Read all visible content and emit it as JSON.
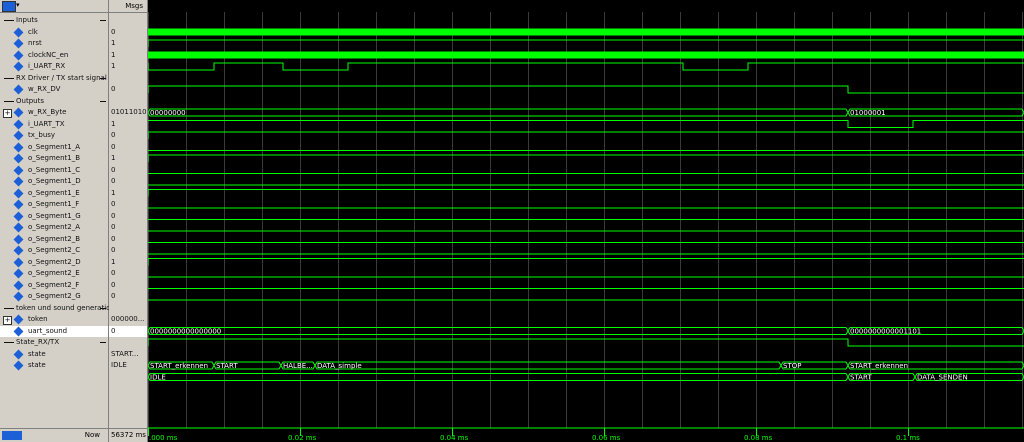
{
  "header": {
    "icon_name": "wave-tool-icon",
    "msgs_label": "Msgs"
  },
  "rows": [
    {
      "kind": "group",
      "name": "Inputs"
    },
    {
      "kind": "signal",
      "name": "clk",
      "value": "0"
    },
    {
      "kind": "signal",
      "name": "nrst",
      "value": "1"
    },
    {
      "kind": "signal",
      "name": "clockNC_en",
      "value": "1"
    },
    {
      "kind": "signal",
      "name": "i_UART_RX",
      "value": "1"
    },
    {
      "kind": "group",
      "name": "RX Driver / TX start signal"
    },
    {
      "kind": "signal",
      "name": "w_RX_DV",
      "value": "0"
    },
    {
      "kind": "group",
      "name": "Outputs"
    },
    {
      "kind": "signal",
      "name": "w_RX_Byte",
      "value": "01011010",
      "expandable": true
    },
    {
      "kind": "signal",
      "name": "i_UART_TX",
      "value": "1"
    },
    {
      "kind": "signal",
      "name": "tx_busy",
      "value": "0"
    },
    {
      "kind": "signal",
      "name": "o_Segment1_A",
      "value": "0"
    },
    {
      "kind": "signal",
      "name": "o_Segment1_B",
      "value": "1"
    },
    {
      "kind": "signal",
      "name": "o_Segment1_C",
      "value": "0"
    },
    {
      "kind": "signal",
      "name": "o_Segment1_D",
      "value": "0"
    },
    {
      "kind": "signal",
      "name": "o_Segment1_E",
      "value": "1"
    },
    {
      "kind": "signal",
      "name": "o_Segment1_F",
      "value": "0"
    },
    {
      "kind": "signal",
      "name": "o_Segment1_G",
      "value": "0"
    },
    {
      "kind": "signal",
      "name": "o_Segment2_A",
      "value": "0"
    },
    {
      "kind": "signal",
      "name": "o_Segment2_B",
      "value": "0"
    },
    {
      "kind": "signal",
      "name": "o_Segment2_C",
      "value": "0"
    },
    {
      "kind": "signal",
      "name": "o_Segment2_D",
      "value": "1"
    },
    {
      "kind": "signal",
      "name": "o_Segment2_E",
      "value": "0"
    },
    {
      "kind": "signal",
      "name": "o_Segment2_F",
      "value": "0"
    },
    {
      "kind": "signal",
      "name": "o_Segment2_G",
      "value": "0"
    },
    {
      "kind": "group",
      "name": "token und sound generation"
    },
    {
      "kind": "signal",
      "name": "token",
      "value": "000000...",
      "expandable": true
    },
    {
      "kind": "signal",
      "name": "uart_sound",
      "value": "0",
      "selected": true
    },
    {
      "kind": "group",
      "name": "State_RX/TX"
    },
    {
      "kind": "signal",
      "name": "state",
      "value": "START..."
    },
    {
      "kind": "signal",
      "name": "state",
      "value": "IDLE"
    }
  ],
  "footer": {
    "now_label": "Now",
    "now_value": "56372 ms"
  },
  "time_ticks": [
    {
      "label": ".000 ms",
      "ms": 0
    },
    {
      "label": "0.02 ms",
      "ms": 0.02
    },
    {
      "label": "0.04 ms",
      "ms": 0.04
    },
    {
      "label": "0.06 ms",
      "ms": 0.06
    },
    {
      "label": "0.08 ms",
      "ms": 0.08
    },
    {
      "label": "0.1 ms",
      "ms": 0.1
    }
  ],
  "bus_labels": {
    "rx_byte_start": "00000000",
    "rx_byte_end": "01000001",
    "token_start": "0000000000000000",
    "token_end": "0000000000001101",
    "state_rx": [
      "START_erkennen",
      "START",
      "HALBE...",
      "DATA_simple",
      "STOP",
      "START_erkennen"
    ],
    "state_tx": [
      "IDLE",
      "START",
      "DATA_SENDEN"
    ]
  },
  "colors": {
    "wave": "#00ff00",
    "bus_text": "#ffffff",
    "grid": "#3a3a3a",
    "icon": "#1c5fd6"
  }
}
